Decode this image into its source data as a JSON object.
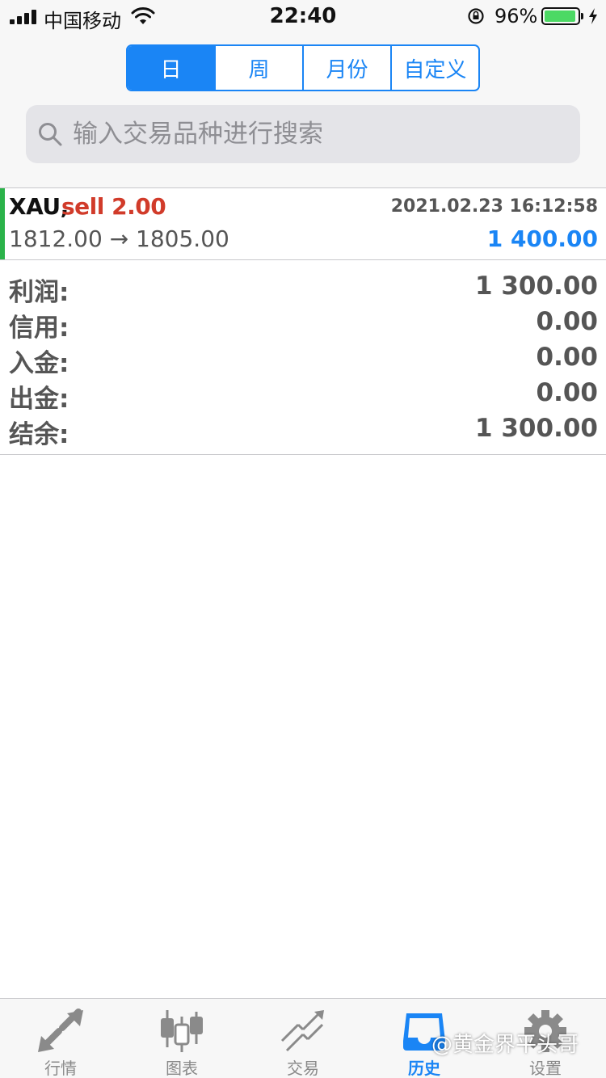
{
  "status_bar": {
    "carrier": "中国移动",
    "time": "22:40",
    "battery_percent": "96%",
    "battery_level": 0.96
  },
  "period_tabs": [
    {
      "label": "日",
      "active": true
    },
    {
      "label": "周",
      "active": false
    },
    {
      "label": "月份",
      "active": false
    },
    {
      "label": "自定义",
      "active": false
    }
  ],
  "search": {
    "placeholder": "输入交易品种进行搜索"
  },
  "trade": {
    "symbol": "XAU,",
    "action": "sell 2.00",
    "datetime": "2021.02.23 16:12:58",
    "prices": "1812.00 → 1805.00",
    "profit": "1 400.00"
  },
  "summary": {
    "rows": [
      {
        "label": "利润:",
        "value": "1 300.00"
      },
      {
        "label": "信用:",
        "value": "0.00"
      },
      {
        "label": "入金:",
        "value": "0.00"
      },
      {
        "label": "出金:",
        "value": "0.00"
      },
      {
        "label": "结余:",
        "value": "1 300.00"
      }
    ]
  },
  "tabbar": {
    "items": [
      {
        "label": "行情",
        "icon": "quotes-icon",
        "active": false
      },
      {
        "label": "图表",
        "icon": "chart-icon",
        "active": false
      },
      {
        "label": "交易",
        "icon": "trade-icon",
        "active": false
      },
      {
        "label": "历史",
        "icon": "history-icon",
        "active": true
      },
      {
        "label": "设置",
        "icon": "settings-icon",
        "active": false
      }
    ]
  },
  "watermark": "@黄金界平头哥",
  "colors": {
    "accent": "#1a85f5",
    "sell": "#d13b2a",
    "trade_marker": "#2bb34a",
    "battery": "#4cd964"
  }
}
